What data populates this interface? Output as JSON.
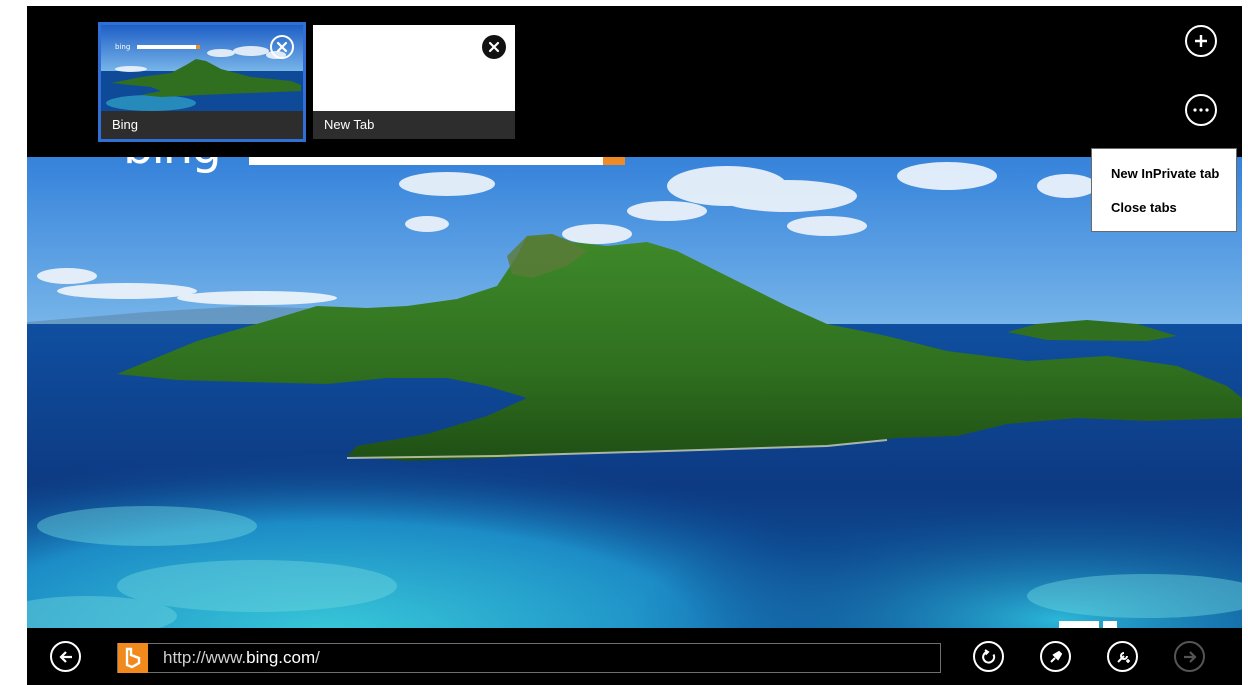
{
  "tabs": [
    {
      "title": "Bing",
      "active": true
    },
    {
      "title": "New Tab",
      "active": false
    }
  ],
  "tab_bar": {
    "new_tab_icon": "plus-circle-icon",
    "more_icon": "ellipsis-circle-icon"
  },
  "menu": {
    "items": [
      "New InPrivate tab",
      "Close tabs"
    ]
  },
  "address_bar": {
    "prefix": "http://www.",
    "domain": "bing.com",
    "suffix": "/",
    "favicon_letter": "b"
  },
  "bing_header": {
    "logo_fragment": "bing"
  },
  "icons": {
    "back": "back-arrow-icon",
    "refresh": "refresh-icon",
    "pin": "pin-icon",
    "page_tools": "page-tools-icon",
    "forward": "forward-arrow-icon"
  },
  "colors": {
    "accent_tab": "#2f6fd6",
    "favicon": "#f2891d",
    "bar": "#000000"
  }
}
